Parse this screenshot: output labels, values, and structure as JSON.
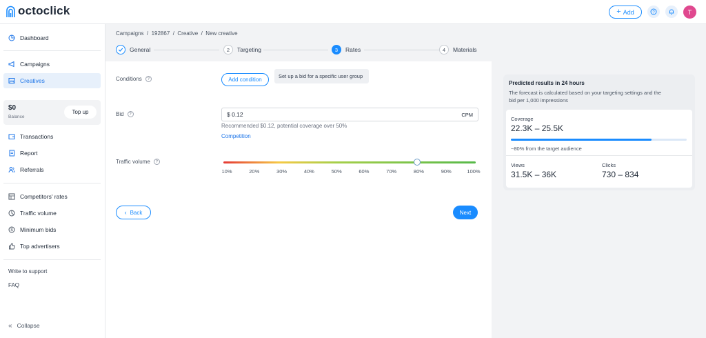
{
  "app": {
    "logo_text": "octoclick"
  },
  "header": {
    "add_label": "Add",
    "avatar_letter": "T"
  },
  "sidebar": {
    "items_top": [
      {
        "label": "Dashboard",
        "icon": "pie-chart-icon"
      }
    ],
    "items_main": [
      {
        "label": "Campaigns",
        "icon": "megaphone-icon"
      },
      {
        "label": "Creatives",
        "icon": "image-icon",
        "active": true
      }
    ],
    "balance": {
      "amount": "$0",
      "label": "Balance",
      "topup_label": "Top up"
    },
    "items_finance": [
      {
        "label": "Transactions",
        "icon": "wallet-icon"
      },
      {
        "label": "Report",
        "icon": "report-icon"
      },
      {
        "label": "Referrals",
        "icon": "users-icon"
      }
    ],
    "items_tools": [
      {
        "label": "Competitors' rates",
        "icon": "table-icon"
      },
      {
        "label": "Traffic volume",
        "icon": "pie-icon"
      },
      {
        "label": "Minimum bids",
        "icon": "dollar-icon"
      },
      {
        "label": "Top advertisers",
        "icon": "thumbs-up-icon"
      }
    ],
    "support_label": "Write to support",
    "faq_label": "FAQ",
    "collapse_label": "Collapse"
  },
  "breadcrumb": "Campaigns  /  192867  /  Creative  /  New creative",
  "steps": [
    {
      "number": "1",
      "label": "General",
      "state": "done"
    },
    {
      "number": "2",
      "label": "Targeting",
      "state": "todo"
    },
    {
      "number": "3",
      "label": "Rates",
      "state": "current"
    },
    {
      "number": "4",
      "label": "Materials",
      "state": "todo"
    }
  ],
  "form": {
    "conditions_label": "Conditions",
    "add_condition_label": "Add condition",
    "conditions_tip": "Set up a bid for a specific user group",
    "bid_label": "Bid",
    "bid_value": "$ 0.12",
    "bid_unit": "CPM",
    "bid_hint": "Recommended $0.12, potential coverage over 50%",
    "competition_link": "Competition",
    "traffic_label": "Traffic volume",
    "traffic_value_percent": 80,
    "traffic_ticks": [
      "10%",
      "20%",
      "30%",
      "40%",
      "50%",
      "60%",
      "70%",
      "80%",
      "90%",
      "100%"
    ],
    "back_label": "Back",
    "next_label": "Next"
  },
  "prediction": {
    "title": "Predicted results in 24 hours",
    "desc": "The forecast is calculated based on your targeting settings and the bid per 1,000 impressions",
    "coverage_label": "Coverage",
    "coverage_value": "22.3K – 25.5K",
    "coverage_fraction": 0.8,
    "coverage_note": "~80% from the target audience",
    "views_label": "Views",
    "views_value": "31.5K – 36K",
    "clicks_label": "Clicks",
    "clicks_value": "730 – 834"
  },
  "colors": {
    "accent": "#1a8cff",
    "avatar": "#e0488f"
  }
}
